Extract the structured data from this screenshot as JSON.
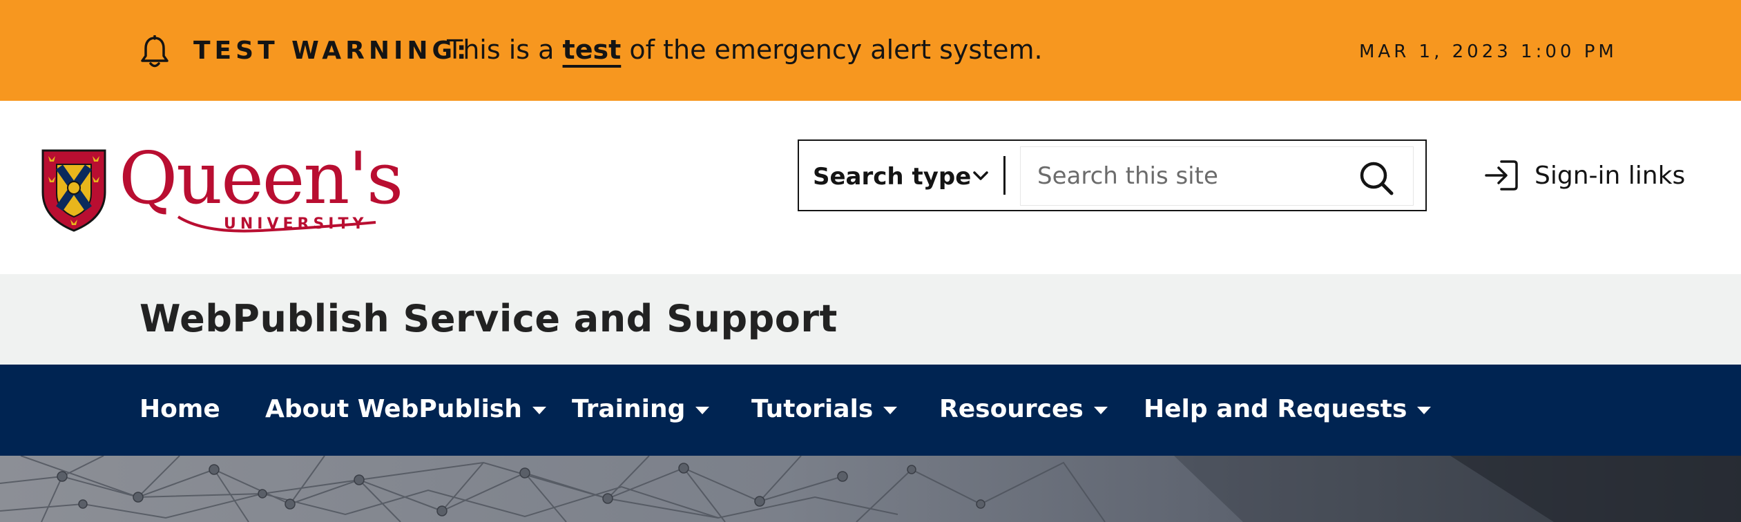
{
  "alert": {
    "title": "TEST WARNING:",
    "message_before": "This is a",
    "message_link": "test",
    "message_after": "of the emergency alert system.",
    "date": "MAR 1, 2023 1:00 PM",
    "icon": "bell-icon",
    "color": "#f7971f"
  },
  "logo": {
    "wordmark": "Queen's",
    "subtitle": "UNIVERSITY",
    "brand_color": "#b90e31"
  },
  "search": {
    "type_label": "Search type",
    "placeholder": "Search this site",
    "chevron_icon": "chevron-down-icon",
    "button_icon": "search-icon"
  },
  "signin": {
    "label": "Sign-in links",
    "icon": "sign-in-icon"
  },
  "site": {
    "title": "WebPublish Service and Support"
  },
  "nav": {
    "background": "#002452",
    "items": [
      {
        "label": "Home",
        "has_dropdown": false
      },
      {
        "label": "About WebPublish",
        "has_dropdown": true
      },
      {
        "label": "Training",
        "has_dropdown": true
      },
      {
        "label": "Tutorials",
        "has_dropdown": true
      },
      {
        "label": "Resources",
        "has_dropdown": true
      },
      {
        "label": "Help and Requests",
        "has_dropdown": true
      }
    ]
  }
}
